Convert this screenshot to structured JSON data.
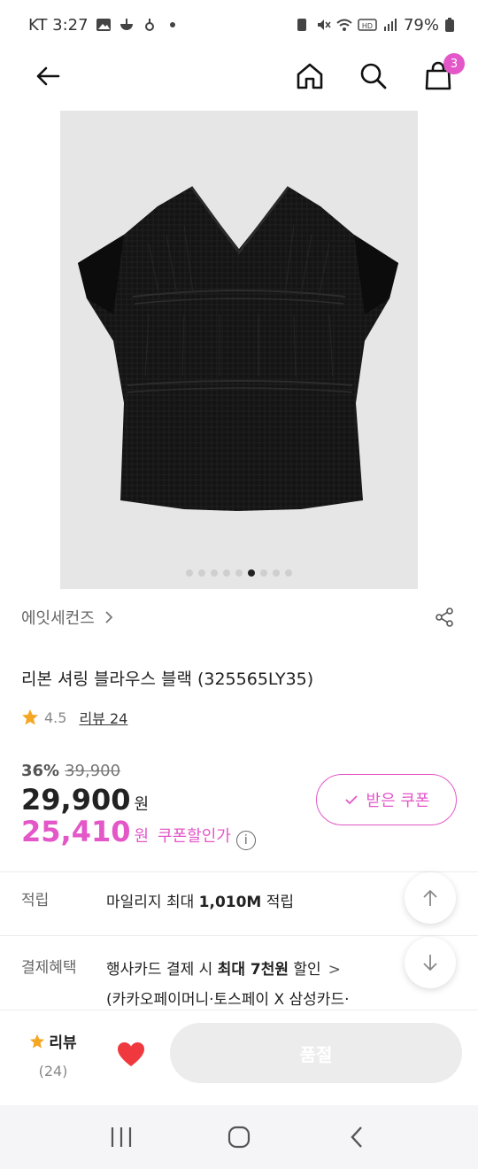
{
  "status": {
    "carrier_time": "KT 3:27",
    "battery": "79%"
  },
  "nav": {
    "cart_count": "3"
  },
  "gallery": {
    "dot_count": 9,
    "active_index": 5
  },
  "product": {
    "brand": "에잇세컨즈",
    "title": "리본 셔링 블라우스 블랙 (325565LY35)",
    "rating": "4.5",
    "review_link": "리뷰 24",
    "discount_percent": "36%",
    "original_price": "39,900",
    "price": "29,900",
    "currency": "원",
    "coupon_price": "25,410",
    "coupon_label": "쿠폰할인가",
    "coupon_button": "받은 쿠폰"
  },
  "info": {
    "points_label": "적립",
    "points_value_pre": "마일리지 최대 ",
    "points_value_bold": "1,010M",
    "points_value_post": " 적립",
    "benefit_label": "결제혜택",
    "benefit_line1_pre": "행사카드 결제 시 ",
    "benefit_line1_bold": "최대 7천원",
    "benefit_line1_post": " 할인",
    "benefit_line2": "(카카오페이머니·토스페이 X 삼성카드·"
  },
  "bottom": {
    "review_label": "리뷰",
    "review_count": "(24)",
    "soldout_label": "품절"
  },
  "colors": {
    "accent": "#e357c8",
    "heart": "#f0393e",
    "star": "#f5a623"
  }
}
